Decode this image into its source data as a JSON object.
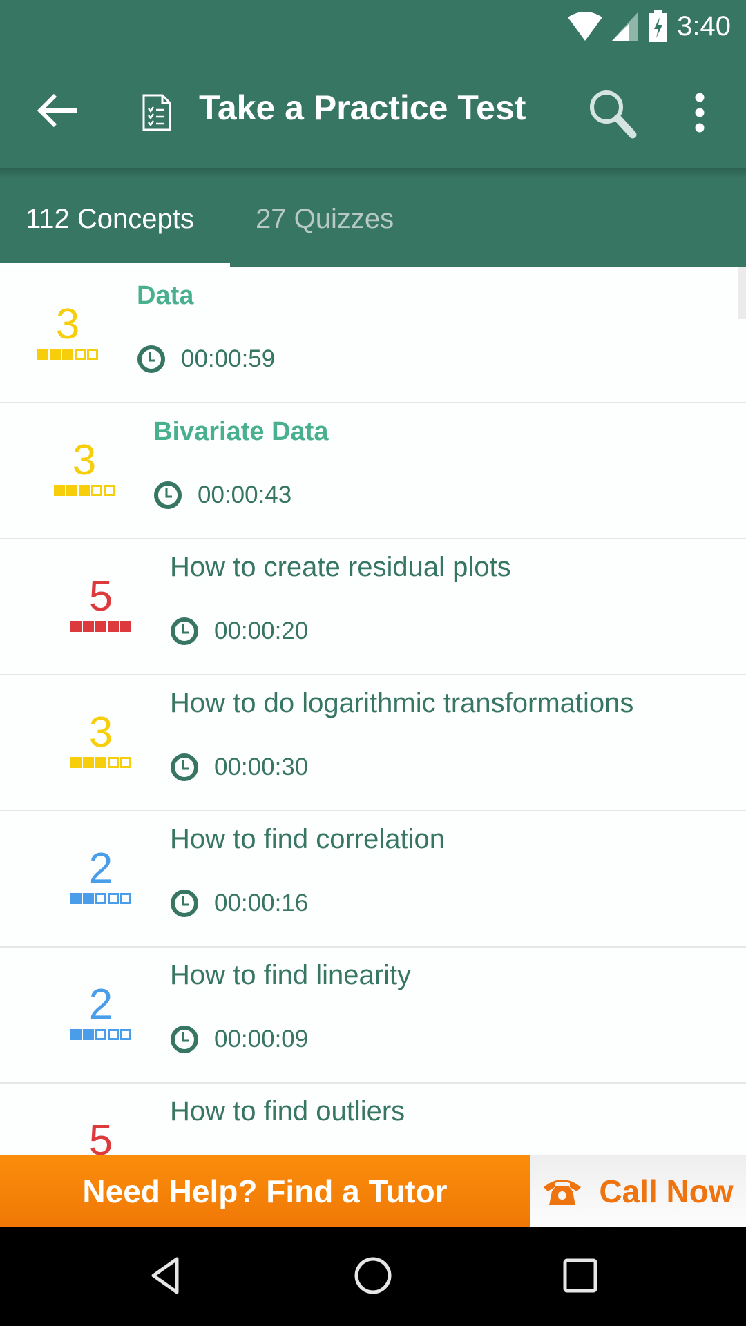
{
  "status_bar": {
    "time": "3:40",
    "icons": [
      "wifi-icon",
      "signal-icon",
      "battery-charging-icon"
    ]
  },
  "app_bar": {
    "title": "Take a Practice Test",
    "back_icon": "arrow-left-icon",
    "title_icon": "checklist-document-icon",
    "search_icon": "search-icon",
    "more_icon": "more-vertical-icon"
  },
  "tabs": [
    {
      "label": "112 Concepts",
      "active": true
    },
    {
      "label": "27 Quizzes",
      "active": false
    }
  ],
  "colors": {
    "primary": "#387664",
    "accent_text": "#48b08e",
    "level_yellow": "#f6ce0c",
    "level_red": "#dc3a3c",
    "level_blue": "#4a9de8",
    "cta_orange": "#f47f08"
  },
  "items": [
    {
      "title": "Data",
      "time": "00:00:59",
      "level": 3,
      "level_max": 5,
      "color": "#f6ce0c",
      "bold": true,
      "indent": 0
    },
    {
      "title": "Bivariate Data",
      "time": "00:00:43",
      "level": 3,
      "level_max": 5,
      "color": "#f6ce0c",
      "bold": true,
      "indent": 1
    },
    {
      "title": "How to create residual plots",
      "time": "00:00:20",
      "level": 5,
      "level_max": 5,
      "color": "#dc3a3c",
      "bold": false,
      "indent": 2
    },
    {
      "title": "How to do logarithmic transformations",
      "time": "00:00:30",
      "level": 3,
      "level_max": 5,
      "color": "#f6ce0c",
      "bold": false,
      "indent": 2
    },
    {
      "title": "How to find correlation",
      "time": "00:00:16",
      "level": 2,
      "level_max": 5,
      "color": "#4a9de8",
      "bold": false,
      "indent": 2
    },
    {
      "title": "How to find linearity",
      "time": "00:00:09",
      "level": 2,
      "level_max": 5,
      "color": "#4a9de8",
      "bold": false,
      "indent": 2
    },
    {
      "title": "How to find outliers",
      "time": "",
      "level": 5,
      "level_max": 5,
      "color": "#dc3a3c",
      "bold": false,
      "indent": 2
    }
  ],
  "cta": {
    "tutor_label": "Need Help? Find a Tutor",
    "call_label": "Call Now"
  },
  "nav": {
    "back": "nav-back-icon",
    "home": "nav-home-icon",
    "recents": "nav-recents-icon"
  }
}
